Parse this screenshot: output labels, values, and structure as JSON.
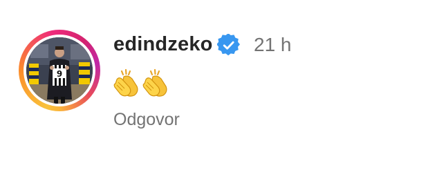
{
  "comment": {
    "username": "edindzeko",
    "verified": true,
    "timestamp": "21 h",
    "content_emojis": [
      "clapping-hands",
      "clapping-hands"
    ],
    "reply_label": "Odgovor",
    "avatar": {
      "icon": "profile-photo",
      "jersey_number": "9",
      "has_story_ring": true
    }
  },
  "colors": {
    "username": "#262626",
    "secondary_text": "#737373",
    "verified_badge": "#3897f0",
    "ring_start": "#f9c13a",
    "ring_end": "#d3236f"
  }
}
